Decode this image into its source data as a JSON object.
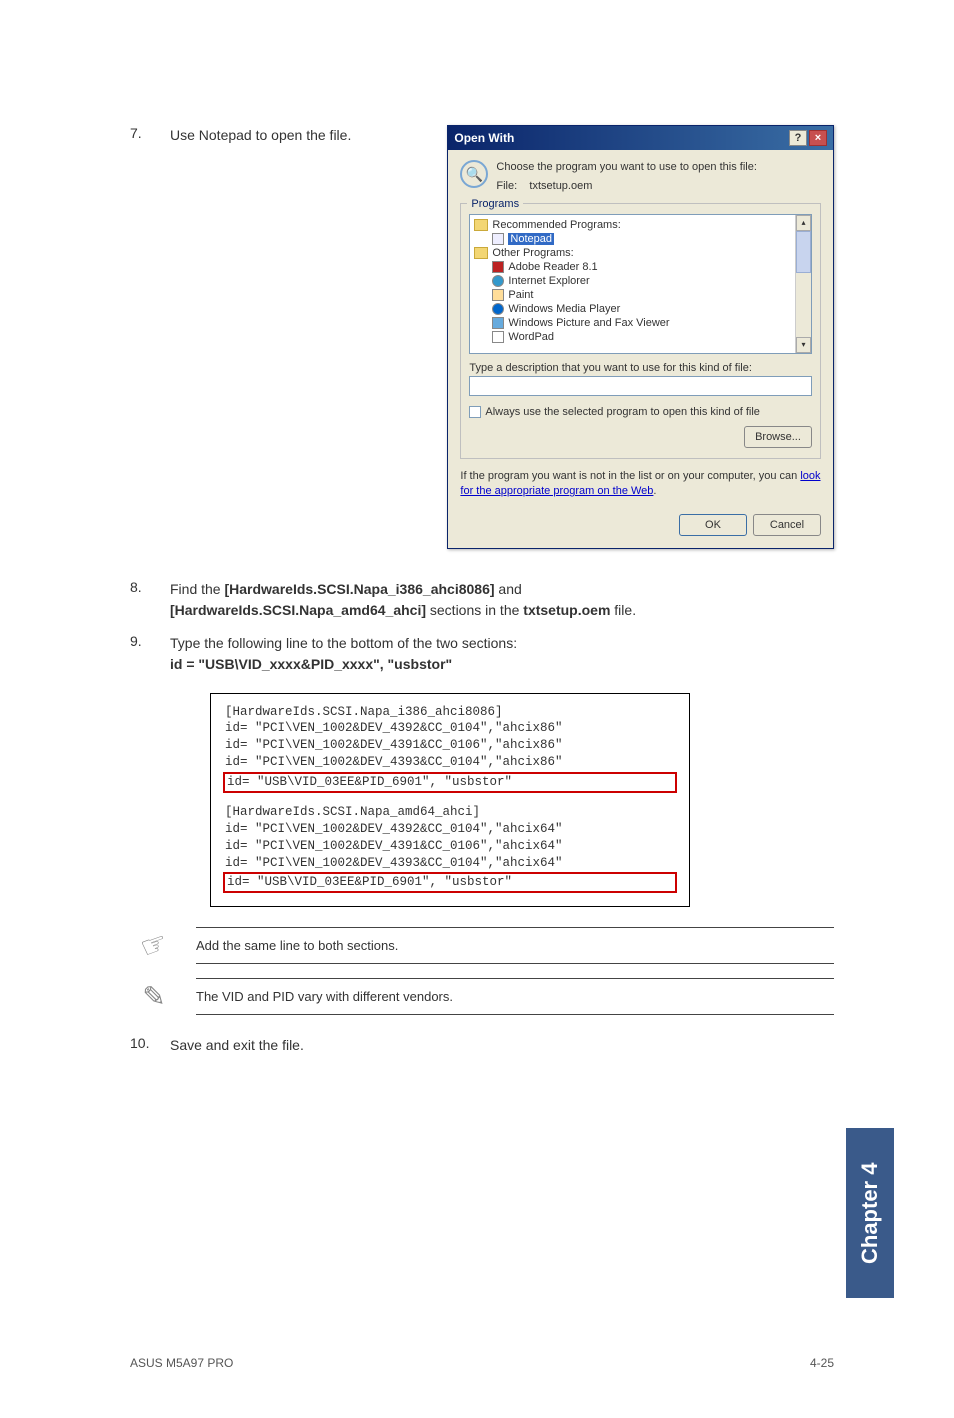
{
  "steps": {
    "s7": {
      "num": "7.",
      "text": "Use Notepad to open the file."
    },
    "s8": {
      "num": "8.",
      "pre": "Find the ",
      "b1": "[HardwareIds.SCSI.Napa_i386_ahci8086]",
      "mid": " and ",
      "b2": "[HardwareIds.SCSI.Napa_amd64_ahci]",
      "post1": " sections in the ",
      "b3": "txtsetup.oem",
      "post2": " file."
    },
    "s9": {
      "num": "9.",
      "line1": "Type the following line to the bottom of the two sections:",
      "line2": "id = \"USB\\VID_xxxx&PID_xxxx\", \"usbstor\""
    },
    "s10": {
      "num": "10.",
      "text": "Save and exit the file."
    }
  },
  "dialog": {
    "title": "Open With",
    "help": "?",
    "close": "×",
    "choose": "Choose the program you want to use to open this file:",
    "filelabel": "File:",
    "filename": "txtsetup.oem",
    "legend": "Programs",
    "rec": "Recommended Programs:",
    "notepad": "Notepad",
    "other": "Other Programs:",
    "p1": "Adobe Reader 8.1",
    "p2": "Internet Explorer",
    "p3": "Paint",
    "p4": "Windows Media Player",
    "p5": "Windows Picture and Fax Viewer",
    "p6": "WordPad",
    "desc": "Type a description that you want to use for this kind of file:",
    "always": "Always use the selected program to open this kind of file",
    "browse": "Browse...",
    "footpre": "If the program you want is not in the list or on your computer, you can ",
    "footlink": "look for the appropriate program on the Web",
    "footpost": ".",
    "ok": "OK",
    "cancel": "Cancel"
  },
  "code": {
    "l1": "[HardwareIds.SCSI.Napa_i386_ahci8086]",
    "l2": "id= \"PCI\\VEN_1002&DEV_4392&CC_0104\",\"ahcix86\"",
    "l3": "id= \"PCI\\VEN_1002&DEV_4391&CC_0106\",\"ahcix86\"",
    "l4": "id= \"PCI\\VEN_1002&DEV_4393&CC_0104\",\"ahcix86\"",
    "l5": "id= \"USB\\VID_03EE&PID_6901\", \"usbstor\"",
    "l6": "[HardwareIds.SCSI.Napa_amd64_ahci]",
    "l7": "id= \"PCI\\VEN_1002&DEV_4392&CC_0104\",\"ahcix64\"",
    "l8": "id= \"PCI\\VEN_1002&DEV_4391&CC_0106\",\"ahcix64\"",
    "l9": "id= \"PCI\\VEN_1002&DEV_4393&CC_0104\",\"ahcix64\"",
    "l10": "id= \"USB\\VID_03EE&PID_6901\", \"usbstor\""
  },
  "notes": {
    "n1": "Add the same line to both sections.",
    "n2": "The VID and PID vary with different vendors."
  },
  "sidetab": "Chapter 4",
  "footer": {
    "left": "ASUS M5A97 PRO",
    "right": "4-25"
  }
}
